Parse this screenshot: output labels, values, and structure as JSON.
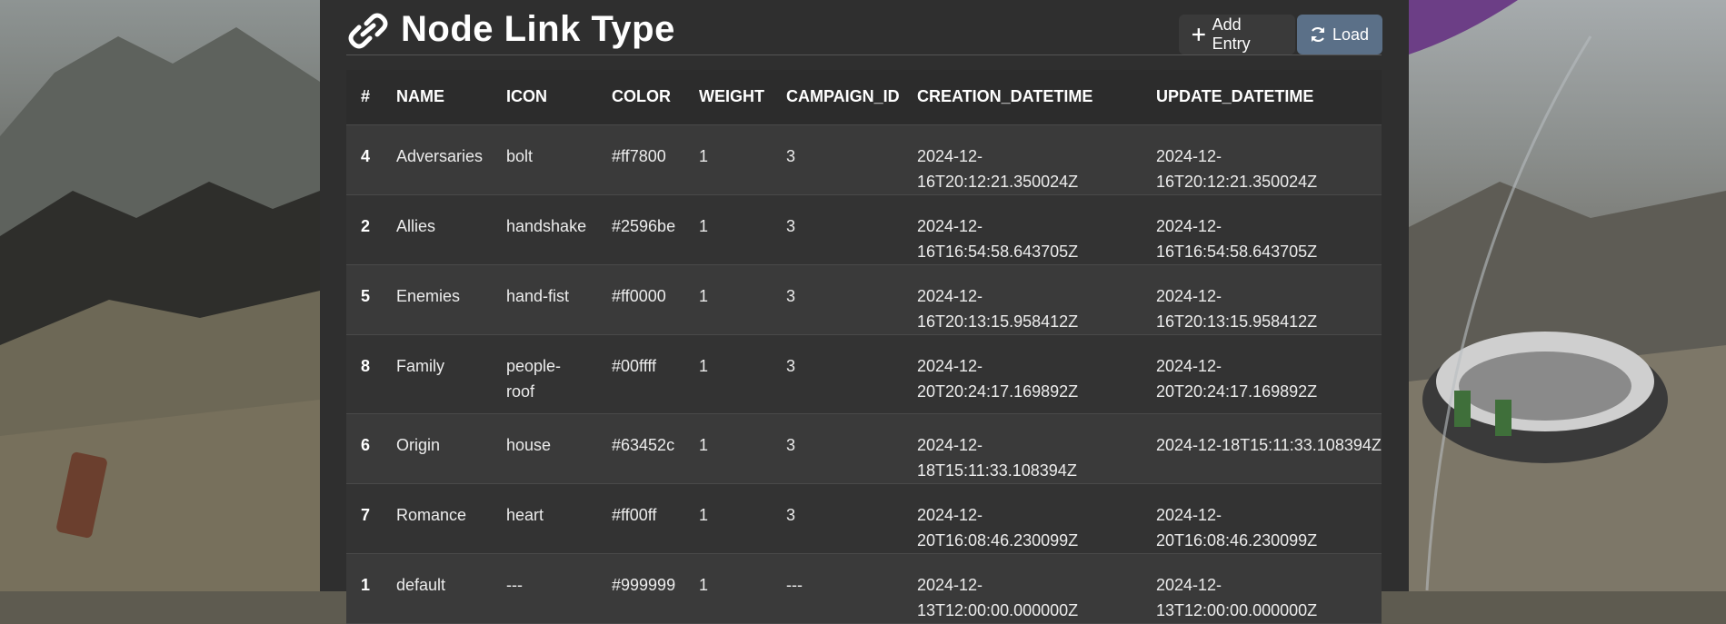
{
  "header": {
    "title": "Node Link Type",
    "add_label": "Add Entry",
    "load_label": "Load"
  },
  "table": {
    "columns": [
      "#",
      "NAME",
      "ICON",
      "COLOR",
      "WEIGHT",
      "CAMPAIGN_ID",
      "CREATION_DATETIME",
      "UPDATE_DATETIME"
    ],
    "rows": [
      {
        "id": "4",
        "name": "Adversaries",
        "icon": "bolt",
        "color": "#ff7800",
        "weight": "1",
        "campaign_id": "3",
        "created": "2024-12-16T20:12:21.350024Z",
        "updated": "2024-12-16T20:12:21.350024Z"
      },
      {
        "id": "2",
        "name": "Allies",
        "icon": "handshake",
        "color": "#2596be",
        "weight": "1",
        "campaign_id": "3",
        "created": "2024-12-16T16:54:58.643705Z",
        "updated": "2024-12-16T16:54:58.643705Z"
      },
      {
        "id": "5",
        "name": "Enemies",
        "icon": "hand-fist",
        "color": "#ff0000",
        "weight": "1",
        "campaign_id": "3",
        "created": "2024-12-16T20:13:15.958412Z",
        "updated": "2024-12-16T20:13:15.958412Z"
      },
      {
        "id": "8",
        "name": "Family",
        "icon": "people-roof",
        "color": "#00ffff",
        "weight": "1",
        "campaign_id": "3",
        "created": "2024-12-20T20:24:17.169892Z",
        "updated": "2024-12-20T20:24:17.169892Z"
      },
      {
        "id": "6",
        "name": "Origin",
        "icon": "house",
        "color": "#63452c",
        "weight": "1",
        "campaign_id": "3",
        "created": "2024-12-18T15:11:33.108394Z",
        "updated": "2024-12-18T15:11:33.108394Z"
      },
      {
        "id": "7",
        "name": "Romance",
        "icon": "heart",
        "color": "#ff00ff",
        "weight": "1",
        "campaign_id": "3",
        "created": "2024-12-20T16:08:46.230099Z",
        "updated": "2024-12-20T16:08:46.230099Z"
      },
      {
        "id": "1",
        "name": "default",
        "icon": "---",
        "color": "#999999",
        "weight": "1",
        "campaign_id": "---",
        "created": "2024-12-13T12:00:00.000000Z",
        "updated": "2024-12-13T12:00:00.000000Z"
      }
    ]
  },
  "icons": {
    "title_icon": "link-icon",
    "add_icon": "plus-icon",
    "load_icon": "refresh-icon"
  },
  "colors": {
    "panel_bg": "#2f2f2f",
    "load_button_bg": "#5b7088",
    "add_button_bg": "#3a3a3a"
  }
}
